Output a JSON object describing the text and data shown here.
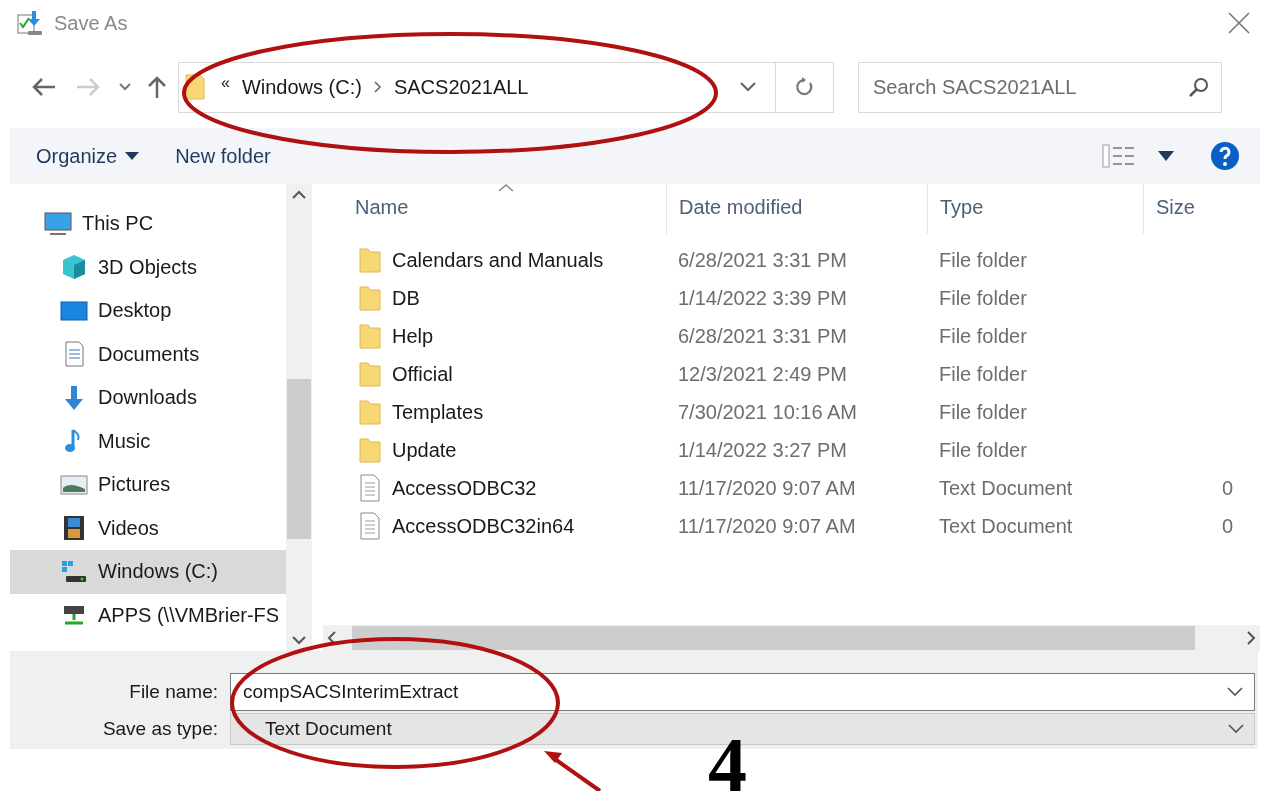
{
  "window": {
    "title": "Save As"
  },
  "address": {
    "overflow": "«",
    "crumbs": [
      "Windows (C:)",
      "SACS2021ALL"
    ]
  },
  "search": {
    "placeholder": "Search SACS2021ALL"
  },
  "toolbar": [
    {
      "kind": "menu",
      "label": "Organize"
    },
    {
      "kind": "button",
      "label": "New folder"
    }
  ],
  "sidebar": {
    "items": [
      {
        "kind": "pc",
        "label": "This PC",
        "selected": false,
        "children": [
          {
            "kind": "cube",
            "label": "3D Objects",
            "selected": false
          },
          {
            "kind": "desktop",
            "label": "Desktop",
            "selected": false
          },
          {
            "kind": "documents",
            "label": "Documents",
            "selected": false
          },
          {
            "kind": "downloads",
            "label": "Downloads",
            "selected": false
          },
          {
            "kind": "music",
            "label": "Music",
            "selected": false
          },
          {
            "kind": "pictures",
            "label": "Pictures",
            "selected": false
          },
          {
            "kind": "videos",
            "label": "Videos",
            "selected": false
          },
          {
            "kind": "drive",
            "label": "Windows (C:)",
            "selected": true
          },
          {
            "kind": "network",
            "label": "APPS (\\\\VMBrier-FS",
            "selected": false
          }
        ]
      }
    ]
  },
  "columns": [
    "Name",
    "Date modified",
    "Type",
    "Size"
  ],
  "rows": [
    {
      "kind": "folder",
      "name": "Calendars and Manuals",
      "date": "6/28/2021 3:31 PM",
      "type": "File folder"
    },
    {
      "kind": "folder",
      "name": "DB",
      "date": "1/14/2022 3:39 PM",
      "type": "File folder"
    },
    {
      "kind": "folder",
      "name": "Help",
      "date": "6/28/2021 3:31 PM",
      "type": "File folder"
    },
    {
      "kind": "folder",
      "name": "Official",
      "date": "12/3/2021 2:49 PM",
      "type": "File folder"
    },
    {
      "kind": "folder",
      "name": "Templates",
      "date": "7/30/2021 10:16 AM",
      "type": "File folder"
    },
    {
      "kind": "folder",
      "name": "Update",
      "date": "1/14/2022 3:27 PM",
      "type": "File folder"
    },
    {
      "kind": "text",
      "name": "AccessODBC32",
      "date": "11/17/2020 9:07 AM",
      "type": "Text Document",
      "size": "0"
    },
    {
      "kind": "text",
      "name": "AccessODBC32in64",
      "date": "11/17/2020 9:07 AM",
      "type": "Text Document",
      "size": "0"
    }
  ],
  "file_name": {
    "label": "File name:",
    "value": "compSACSInterimExtract"
  },
  "save_type": {
    "label": "Save as type:",
    "value": "Text Document"
  },
  "annotation": {
    "number": "4"
  }
}
